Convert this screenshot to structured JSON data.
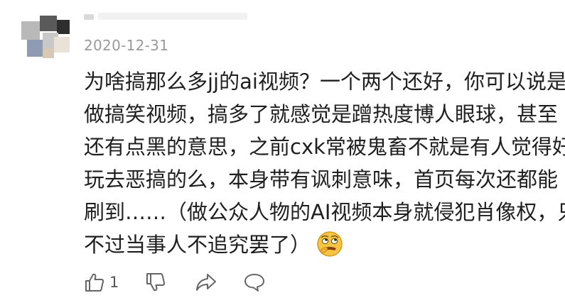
{
  "comment": {
    "date": "2020-12-31",
    "lines": [
      "为啥搞那么多jj的ai视频？一个两个还好，你可以说是",
      "做搞笑视频，搞多了就感觉是蹭热度博人眼球，甚至",
      "还有点黑的意思，之前cxk常被鬼畜不就是有人觉得好",
      "玩去恶搞的么，本身带有讽刺意味，首页每次还都能",
      "刷到……（做公众人物的AI视频本身就侵犯肖像权，只",
      "不过当事人不追究罢了）"
    ],
    "emoji_icon": "rolling-eyes-emoji-icon"
  },
  "actions": {
    "like_count": "1",
    "like_icon": "thumbs-up-icon",
    "dislike_icon": "thumbs-down-icon",
    "share_icon": "share-arrow-icon",
    "reply_icon": "speech-bubble-icon"
  }
}
